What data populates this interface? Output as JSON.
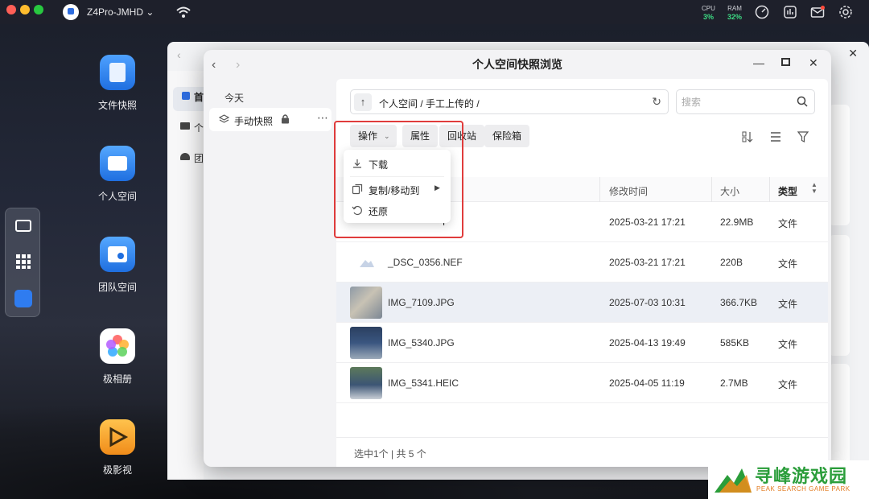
{
  "topbar": {
    "device_name": "Z4Pro-JMHD",
    "cpu_label": "CPU",
    "cpu_value": "3%",
    "ram_label": "RAM",
    "ram_value": "32%"
  },
  "dock": {
    "items": [
      {
        "label": "文件快照"
      },
      {
        "label": "个人空间"
      },
      {
        "label": "团队空间"
      },
      {
        "label": "极相册"
      },
      {
        "label": "极影视"
      }
    ]
  },
  "back_window": {
    "sidebar": [
      "首",
      "个",
      "团"
    ]
  },
  "window": {
    "title": "个人空间快照浏览",
    "left_pane": {
      "group": "今天",
      "item": "手动快照"
    },
    "path": "个人空间 / 手工上传的 /",
    "search_placeholder": "搜索",
    "toolbar": {
      "ops": "操作",
      "props": "属性",
      "recycle": "回收站",
      "vault": "保险箱"
    },
    "menu": {
      "download": "下载",
      "copy_move": "复制/移动到",
      "restore": "还原"
    },
    "table": {
      "headers": {
        "mtime": "修改时间",
        "size": "大小",
        "type": "类型"
      },
      "rows": [
        {
          "name": "F",
          "mtime": "2025-03-21 17:21",
          "size": "22.9MB",
          "type": "文件"
        },
        {
          "name": "_DSC_0356.NEF",
          "mtime": "2025-03-21 17:21",
          "size": "220B",
          "type": "文件"
        },
        {
          "name": "IMG_7109.JPG",
          "mtime": "2025-07-03 10:31",
          "size": "366.7KB",
          "type": "文件"
        },
        {
          "name": "IMG_5340.JPG",
          "mtime": "2025-04-13 19:49",
          "size": "585KB",
          "type": "文件"
        },
        {
          "name": "IMG_5341.HEIC",
          "mtime": "2025-04-05 11:19",
          "size": "2.7MB",
          "type": "文件"
        }
      ]
    },
    "status": "选中1个 | 共 5 个"
  },
  "watermark": {
    "title": "寻峰游戏园",
    "subtitle": "PEAK SEARCH GAME PARK"
  },
  "colors": {
    "accent": "#2d6cdf",
    "highlight": "#e03c3c",
    "selected_row": "#eceff5"
  }
}
